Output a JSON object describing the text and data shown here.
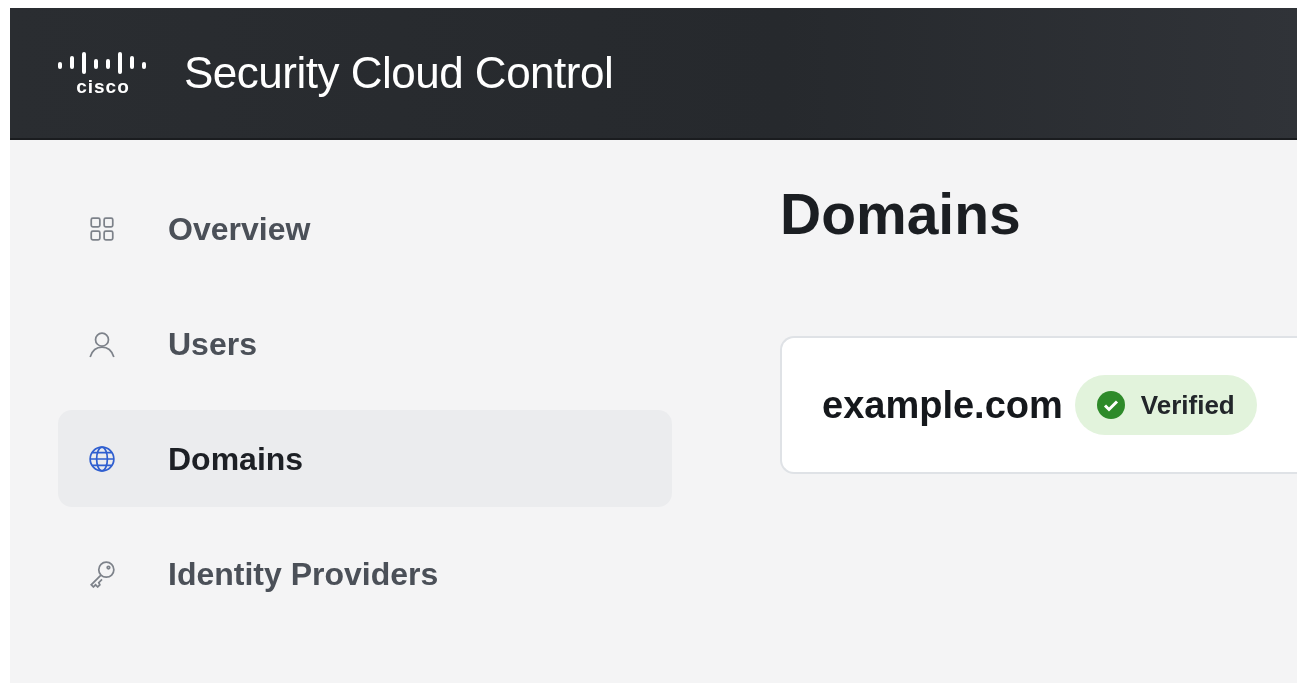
{
  "header": {
    "logo_text": "cisco",
    "title": "Security Cloud Control"
  },
  "sidebar": {
    "items": [
      {
        "label": "Overview",
        "kind": "grid",
        "selected": false
      },
      {
        "label": "Users",
        "kind": "user",
        "selected": false
      },
      {
        "label": "Domains",
        "kind": "globe",
        "selected": true
      },
      {
        "label": "Identity Providers",
        "kind": "key",
        "selected": false
      }
    ]
  },
  "page": {
    "heading": "Domains",
    "domains": [
      {
        "name": "example.com",
        "status": "Verified",
        "verified": true
      }
    ]
  }
}
